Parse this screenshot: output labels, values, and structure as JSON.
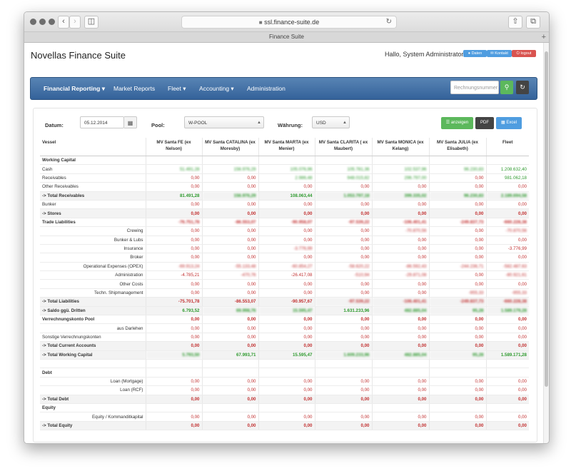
{
  "browser": {
    "address": "ssl.finance-suite.de",
    "tab_title": "Finance Suite"
  },
  "header": {
    "app_title": "Novellas Finance Suite",
    "greeting": "Hallo, System Administrator",
    "buttons": {
      "daten": "Daten",
      "kontakt": "Kontakt",
      "logout": "logout"
    }
  },
  "nav": {
    "items": [
      "Financial Reporting ▾",
      "Market Reports",
      "Fleet ▾",
      "Accounting ▾",
      "Administration"
    ],
    "search_placeholder": "Rechnungsnummer"
  },
  "filters": {
    "datum_label": "Datum:",
    "datum_value": "05.12.2014",
    "pool_label": "Pool:",
    "pool_value": "W-POOL",
    "waehrung_label": "Währung:",
    "waehrung_value": "USD",
    "btn_anzeigen": "anzeigen",
    "btn_pdf": "PDF",
    "btn_excel": "Excel"
  },
  "table": {
    "headers": [
      "Vessel",
      "MV Santa FE (ex Nelson)",
      "MV Santa CATALINA (ex Moresby)",
      "MV Santa MARTA (ex Menier)",
      "MV Santa CLARITA ( ex Maubert)",
      "MV Santa MONICA (ex Kelang)",
      "MV Santa JULIA (ex Elisabeth)",
      "Fleet"
    ],
    "rows": [
      {
        "type": "section",
        "label": "Working Capital",
        "cells": [
          "",
          "",
          "",
          "",
          "",
          "",
          ""
        ]
      },
      {
        "type": "row",
        "align": "left",
        "label": "Cash",
        "cells": [
          "51.491,28",
          "156.976,29",
          "105.076,96",
          "105.781,36",
          "102.537,96",
          "96.230,83",
          "1.208.632,40"
        ],
        "colors": [
          "pos",
          "pos",
          "pos",
          "pos",
          "pos",
          "pos",
          "pos"
        ],
        "blur": [
          1,
          1,
          1,
          1,
          1,
          1,
          0
        ]
      },
      {
        "type": "row",
        "align": "left",
        "label": "Receivables",
        "cells": [
          "0,00",
          "0,00",
          "2.986,48",
          "948.015,82",
          "296.797,00",
          "0,00",
          "981.062,18"
        ],
        "colors": [
          "neg",
          "neg",
          "pos",
          "pos",
          "pos",
          "neg",
          "pos"
        ],
        "blur": [
          0,
          0,
          1,
          1,
          1,
          0,
          0
        ]
      },
      {
        "type": "row",
        "align": "left",
        "label": "Other Receivables",
        "cells": [
          "0,00",
          "0,00",
          "0,00",
          "0,00",
          "0,00",
          "0,00",
          "0,00"
        ],
        "colors": [
          "neg",
          "neg",
          "neg",
          "neg",
          "neg",
          "neg",
          "neg"
        ],
        "blur": [
          0,
          0,
          0,
          0,
          0,
          0,
          0
        ]
      },
      {
        "type": "total",
        "label": "-> Total Receivables",
        "cells": [
          "81.491,28",
          "156.976,29",
          "108.063,44",
          "1.053.797,18",
          "399.335,02",
          "96.230,83",
          "2.189.694,58"
        ],
        "colors": [
          "pos",
          "pos",
          "pos",
          "pos",
          "pos",
          "pos",
          "pos"
        ],
        "blur": [
          0,
          1,
          0,
          1,
          1,
          1,
          1
        ]
      },
      {
        "type": "row",
        "align": "left",
        "label": "Bunker",
        "cells": [
          "0,00",
          "0,00",
          "0,00",
          "0,00",
          "0,00",
          "0,00",
          "0,00"
        ],
        "colors": [
          "neg",
          "neg",
          "neg",
          "neg",
          "neg",
          "neg",
          "neg"
        ],
        "blur": [
          0,
          0,
          0,
          0,
          0,
          0,
          0
        ]
      },
      {
        "type": "total",
        "label": "-> Stores",
        "cells": [
          "0,00",
          "0,00",
          "0,00",
          "0,00",
          "0,00",
          "0,00",
          "0,00"
        ],
        "colors": [
          "neg",
          "neg",
          "neg",
          "neg",
          "neg",
          "neg",
          "neg"
        ],
        "blur": [
          0,
          0,
          0,
          0,
          0,
          0,
          0
        ]
      },
      {
        "type": "section",
        "label": "Trade Liabilities",
        "cells": [
          "-76.751,78",
          "-86.553,07",
          "-90.958,07",
          "-97.539,22",
          "-106.401,41",
          "-249.837,73",
          "-660.228,38"
        ],
        "colors": [
          "neg",
          "neg",
          "neg",
          "neg",
          "neg",
          "neg",
          "neg"
        ],
        "blur": [
          1,
          1,
          1,
          1,
          1,
          1,
          1
        ]
      },
      {
        "type": "row",
        "align": "right",
        "label": "Crewing",
        "cells": [
          "0,00",
          "0,00",
          "0,00",
          "0,00",
          "-70.870,56",
          "0,00",
          "-70.870,56"
        ],
        "colors": [
          "neg",
          "neg",
          "neg",
          "neg",
          "neg",
          "neg",
          "neg"
        ],
        "blur": [
          0,
          0,
          0,
          0,
          1,
          0,
          1
        ]
      },
      {
        "type": "row",
        "align": "right",
        "label": "Bunker & Lubs",
        "cells": [
          "0,00",
          "0,00",
          "0,00",
          "0,00",
          "0,00",
          "0,00",
          "0,00"
        ],
        "colors": [
          "neg",
          "neg",
          "neg",
          "neg",
          "neg",
          "neg",
          "neg"
        ],
        "blur": [
          0,
          0,
          0,
          0,
          0,
          0,
          0
        ]
      },
      {
        "type": "row",
        "align": "right",
        "label": "Insurance",
        "cells": [
          "0,00",
          "0,00",
          "-3.776,99",
          "0,00",
          "0,00",
          "0,00",
          "-3.776,99"
        ],
        "colors": [
          "neg",
          "neg",
          "neg",
          "neg",
          "neg",
          "neg",
          "neg"
        ],
        "blur": [
          0,
          0,
          1,
          0,
          0,
          0,
          0
        ]
      },
      {
        "type": "row",
        "align": "right",
        "label": "Broker",
        "cells": [
          "0,00",
          "0,00",
          "0,00",
          "0,00",
          "0,00",
          "0,00",
          "0,00"
        ],
        "colors": [
          "neg",
          "neg",
          "neg",
          "neg",
          "neg",
          "neg",
          "neg"
        ],
        "blur": [
          0,
          0,
          0,
          0,
          0,
          0,
          0
        ]
      },
      {
        "type": "row",
        "align": "right",
        "label": "Operational Expenses (OPEX)",
        "cells": [
          "-69.913,24",
          "-55.133,48",
          "-60.854,27",
          "-58.620,22",
          "-86.592,43",
          "-244.236,71",
          "-582.487,63"
        ],
        "colors": [
          "neg",
          "neg",
          "neg",
          "neg",
          "neg",
          "neg",
          "neg"
        ],
        "blur": [
          1,
          1,
          1,
          1,
          1,
          1,
          1
        ]
      },
      {
        "type": "row",
        "align": "right",
        "label": "Administration",
        "cells": [
          "-4.785,21",
          "-470,76",
          "-26.417,08",
          "-510,94",
          "-29.871,08",
          "0,00",
          "-80.921,61"
        ],
        "colors": [
          "neg",
          "neg",
          "neg",
          "neg",
          "neg",
          "neg",
          "neg"
        ],
        "blur": [
          0,
          1,
          0,
          1,
          1,
          0,
          1
        ]
      },
      {
        "type": "row",
        "align": "right",
        "label": "Other Costs",
        "cells": [
          "0,00",
          "0,00",
          "0,00",
          "0,00",
          "0,00",
          "0,00",
          "0,00"
        ],
        "colors": [
          "neg",
          "neg",
          "neg",
          "neg",
          "neg",
          "neg",
          "neg"
        ],
        "blur": [
          0,
          0,
          0,
          0,
          0,
          0,
          0
        ]
      },
      {
        "type": "row",
        "align": "right",
        "label": "Techn. Shipmanagement",
        "cells": [
          "0,00",
          "0,00",
          "0,00",
          "0,00",
          "0,00",
          "-955,33",
          "-955,33"
        ],
        "colors": [
          "neg",
          "neg",
          "neg",
          "neg",
          "neg",
          "neg",
          "neg"
        ],
        "blur": [
          0,
          0,
          0,
          0,
          0,
          1,
          1
        ]
      },
      {
        "type": "total",
        "label": "-> Total Liabilities",
        "cells": [
          "-75.701,78",
          "-86.553,07",
          "-90.957,67",
          "-97.539,22",
          "-106.401,41",
          "-249.837,73",
          "-660.228,38"
        ],
        "colors": [
          "neg",
          "neg",
          "neg",
          "neg",
          "neg",
          "neg",
          "neg"
        ],
        "blur": [
          0,
          0,
          0,
          1,
          1,
          1,
          1
        ]
      },
      {
        "type": "total",
        "label": "-> Saldo ggü. Dritten",
        "cells": [
          "6.793,52",
          "69.998,76",
          "15.595,47",
          "1.631.233,96",
          "482.885,04",
          "95,28",
          "1.589.179,28"
        ],
        "colors": [
          "pos",
          "pos",
          "pos",
          "pos",
          "pos",
          "pos",
          "pos"
        ],
        "blur": [
          0,
          1,
          1,
          0,
          1,
          1,
          1
        ]
      },
      {
        "type": "section",
        "label": "Verrechnungskonto Pool",
        "cells": [
          "0,00",
          "0,00",
          "0,00",
          "0,00",
          "0,00",
          "0,00",
          "0,00"
        ],
        "colors": [
          "neg",
          "neg",
          "neg",
          "neg",
          "neg",
          "neg",
          "neg"
        ],
        "blur": [
          0,
          0,
          0,
          0,
          0,
          0,
          0
        ]
      },
      {
        "type": "row",
        "align": "right",
        "label": "aus Darlehen",
        "cells": [
          "0,00",
          "0,00",
          "0,00",
          "0,00",
          "0,00",
          "0,00",
          "0,00"
        ],
        "colors": [
          "neg",
          "neg",
          "neg",
          "neg",
          "neg",
          "neg",
          "neg"
        ],
        "blur": [
          0,
          0,
          0,
          0,
          0,
          0,
          0
        ]
      },
      {
        "type": "row",
        "align": "left",
        "label": "Sonstige Verrechnungskonten",
        "cells": [
          "0,00",
          "0,00",
          "0,00",
          "0,00",
          "0,00",
          "0,00",
          "0,00"
        ],
        "colors": [
          "neg",
          "neg",
          "neg",
          "neg",
          "neg",
          "neg",
          "neg"
        ],
        "blur": [
          0,
          0,
          0,
          0,
          0,
          0,
          0
        ]
      },
      {
        "type": "total",
        "label": "-> Total Current Accounts",
        "cells": [
          "0,00",
          "0,00",
          "0,00",
          "0,00",
          "0,00",
          "0,00",
          "0,00"
        ],
        "colors": [
          "neg",
          "neg",
          "neg",
          "neg",
          "neg",
          "neg",
          "neg"
        ],
        "blur": [
          0,
          0,
          0,
          0,
          0,
          0,
          0
        ]
      },
      {
        "type": "total",
        "label": "-> Total Working Capital",
        "cells": [
          "5.793,50",
          "67.993,71",
          "15.595,47",
          "1.609.233,96",
          "482.885,04",
          "95,28",
          "1.589.171,28"
        ],
        "colors": [
          "pos",
          "pos",
          "pos",
          "pos",
          "pos",
          "pos",
          "pos"
        ],
        "blur": [
          1,
          0,
          0,
          1,
          1,
          1,
          0
        ]
      },
      {
        "type": "blank",
        "label": "",
        "cells": [
          "",
          "",
          "",
          "",
          "",
          "",
          ""
        ]
      },
      {
        "type": "section",
        "label": "Debt",
        "cells": [
          "",
          "",
          "",
          "",
          "",
          "",
          ""
        ]
      },
      {
        "type": "row",
        "align": "right",
        "label": "Loan (Mortgage)",
        "cells": [
          "0,00",
          "0,00",
          "0,00",
          "0,00",
          "0,00",
          "0,00",
          "0,00"
        ],
        "colors": [
          "neg",
          "neg",
          "neg",
          "neg",
          "neg",
          "neg",
          "neg"
        ],
        "blur": [
          0,
          0,
          0,
          0,
          0,
          0,
          0
        ]
      },
      {
        "type": "row",
        "align": "right",
        "label": "Loan (RCF)",
        "cells": [
          "0,00",
          "0,00",
          "0,00",
          "0,00",
          "0,00",
          "0,00",
          "0,00"
        ],
        "colors": [
          "neg",
          "neg",
          "neg",
          "neg",
          "neg",
          "neg",
          "neg"
        ],
        "blur": [
          0,
          0,
          0,
          0,
          0,
          0,
          0
        ]
      },
      {
        "type": "total",
        "label": "-> Total Debt",
        "cells": [
          "0,00",
          "0,00",
          "0,00",
          "0,00",
          "0,00",
          "0,00",
          "0,00"
        ],
        "colors": [
          "neg",
          "neg",
          "neg",
          "neg",
          "neg",
          "neg",
          "neg"
        ],
        "blur": [
          0,
          0,
          0,
          0,
          0,
          0,
          0
        ]
      },
      {
        "type": "section",
        "label": "Equity",
        "cells": [
          "",
          "",
          "",
          "",
          "",
          "",
          ""
        ]
      },
      {
        "type": "row",
        "align": "right",
        "label": "Equity / Kommanditkapital",
        "cells": [
          "0,00",
          "0,00",
          "0,00",
          "0,00",
          "0,00",
          "0,00",
          "0,00"
        ],
        "colors": [
          "neg",
          "neg",
          "neg",
          "neg",
          "neg",
          "neg",
          "neg"
        ],
        "blur": [
          0,
          0,
          0,
          0,
          0,
          0,
          0
        ]
      },
      {
        "type": "total",
        "label": "-> Total Equity",
        "cells": [
          "0,00",
          "0,00",
          "0,00",
          "0,00",
          "0,00",
          "0,00",
          "0,00"
        ],
        "colors": [
          "neg",
          "neg",
          "neg",
          "neg",
          "neg",
          "neg",
          "neg"
        ],
        "blur": [
          0,
          0,
          0,
          0,
          0,
          0,
          0
        ]
      }
    ]
  },
  "colors": {
    "nav_top": "#5884b4",
    "nav_bottom": "#34629a",
    "positive": "#2f9a2f",
    "negative": "#c23131",
    "btn_green": "#5cb85c",
    "btn_dark": "#444444",
    "btn_blue": "#4f9de0",
    "btn_red": "#d9534f"
  }
}
